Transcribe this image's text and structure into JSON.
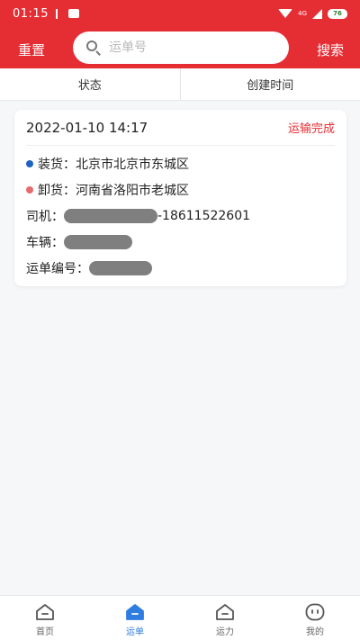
{
  "statusbar": {
    "time": "01:15",
    "network": "4G",
    "battery": "76"
  },
  "search": {
    "reset_label": "重置",
    "placeholder": "运单号",
    "search_label": "搜索"
  },
  "filters": [
    {
      "label": "状态"
    },
    {
      "label": "创建时间"
    }
  ],
  "orders": [
    {
      "date": "2022-01-10 14:17",
      "status": "运输完成",
      "load_label": "装货：",
      "load_address": "北京市北京市东城区",
      "unload_label": "卸货：",
      "unload_address": "河南省洛阳市老城区",
      "driver_label": "司机：",
      "driver_phone": "-18611522601",
      "vehicle_label": "车辆：",
      "waybill_label": "运单编号："
    }
  ],
  "tabbar": [
    {
      "label": "首页",
      "icon": "home-icon"
    },
    {
      "label": "运单",
      "icon": "waybill-icon"
    },
    {
      "label": "运力",
      "icon": "capacity-icon"
    },
    {
      "label": "我的",
      "icon": "profile-icon"
    }
  ],
  "colors": {
    "brand": "#e52d34",
    "active_tab": "#2f7de1",
    "load_dot": "#1e63c1",
    "unload_dot": "#e86b6b"
  }
}
